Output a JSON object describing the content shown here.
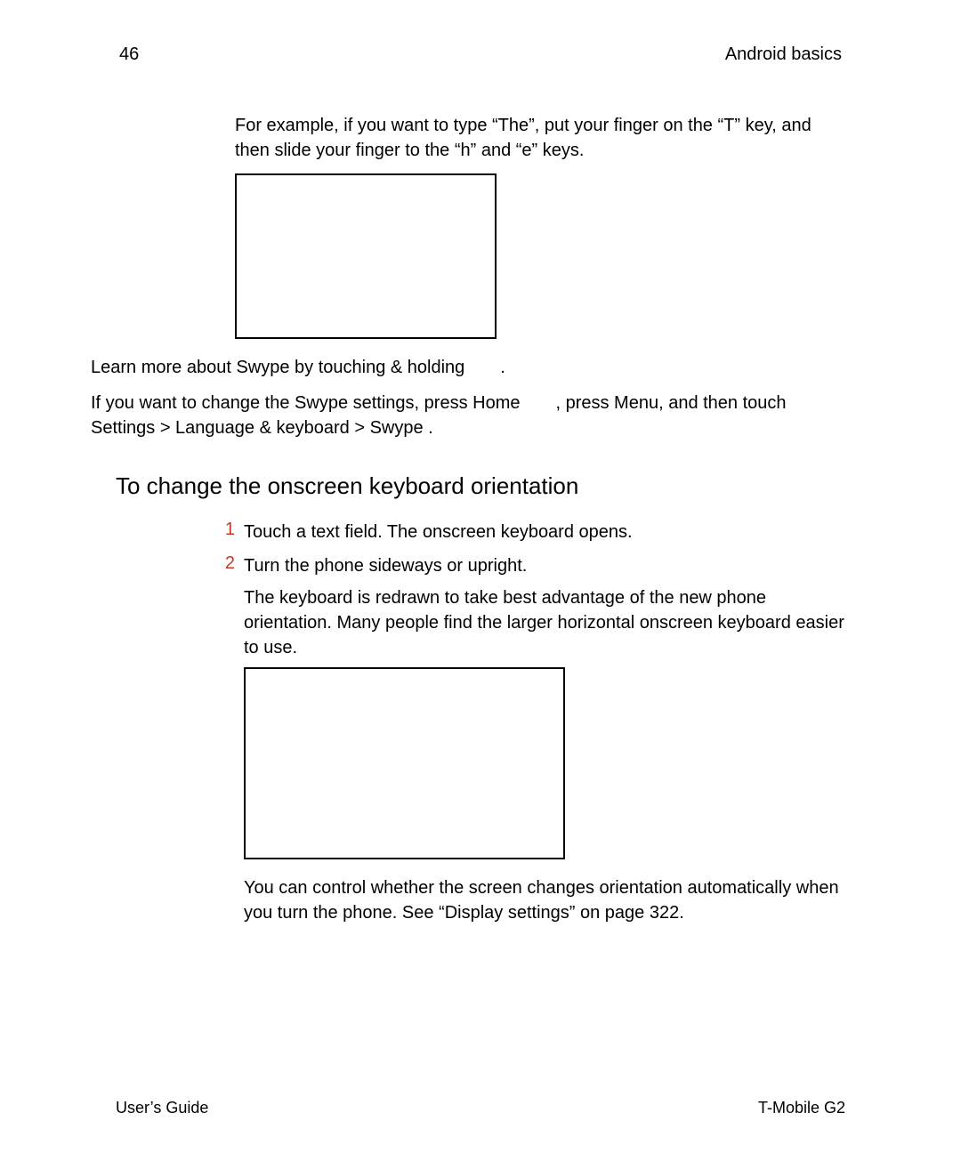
{
  "header": {
    "page_number": "46",
    "section": "Android basics"
  },
  "body": {
    "example_para": "For example, if you want to type “The”, put your finger on the “T” key, and then slide your finger to the “h” and “e” keys.",
    "learn_more": "Learn more about Swype by touching & holding  .",
    "settings_line_1": "If you want to change the Swype settings, press Home  , press Menu, and then touch ",
    "settings_path": "Settings > Language & keyboard > Swype",
    "settings_line_end": " .",
    "section_title": "To change the onscreen keyboard orientation",
    "steps": {
      "s1_num": "1",
      "s1_text": "Touch a text field. The onscreen keyboard opens.",
      "s2_num": "2",
      "s2_text": "Turn the phone sideways or upright.",
      "s2_sub": "The keyboard is redrawn to take best advantage of the new phone orientation. Many people find the larger horizontal onscreen keyboard easier to use.",
      "s2_after": "You can control whether the screen changes orientation automatically when you turn the phone. See “Display settings” on page 322."
    }
  },
  "footer": {
    "left": "User’s Guide",
    "right": "T-Mobile G2"
  }
}
